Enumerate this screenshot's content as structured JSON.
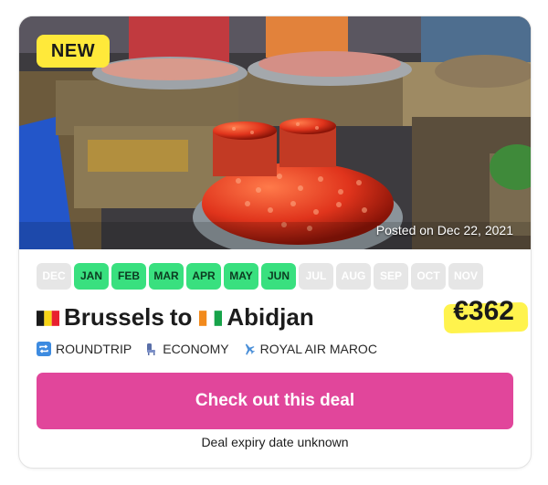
{
  "badge": "NEW",
  "posted": "Posted on Dec 22, 2021",
  "months": [
    {
      "label": "DEC",
      "active": false
    },
    {
      "label": "JAN",
      "active": true
    },
    {
      "label": "FEB",
      "active": true
    },
    {
      "label": "MAR",
      "active": true
    },
    {
      "label": "APR",
      "active": true
    },
    {
      "label": "MAY",
      "active": true
    },
    {
      "label": "JUN",
      "active": true
    },
    {
      "label": "JUL",
      "active": false
    },
    {
      "label": "AUG",
      "active": false
    },
    {
      "label": "SEP",
      "active": false
    },
    {
      "label": "OCT",
      "active": false
    },
    {
      "label": "NOV",
      "active": false
    }
  ],
  "route": {
    "origin": "Brussels",
    "connector": "to",
    "destination": "Abidjan",
    "origin_flag": "belgium-flag",
    "destination_flag": "ivory-coast-flag"
  },
  "price": "€362",
  "details": {
    "trip_type": "ROUNDTRIP",
    "cabin": "ECONOMY",
    "airline": "ROYAL AIR MAROC",
    "trip_icon": "repeat-arrows-icon",
    "cabin_icon": "seat-icon",
    "airline_icon": "airplane-icon"
  },
  "cta": "Check out this deal",
  "expiry": "Deal expiry date unknown",
  "colors": {
    "active_month": "#39e07f",
    "inactive_month": "#e6e6e6",
    "cta": "#e1469b",
    "badge": "#ffe93a",
    "price_highlight": "#fff34d"
  }
}
